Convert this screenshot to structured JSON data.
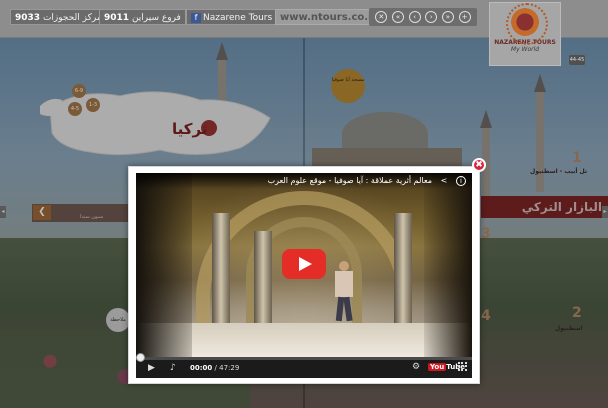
{
  "topbar": {
    "center_pill": "9033",
    "center_pill_text": "مركز الحجوزات",
    "branches_pill": "9011",
    "branches_text": "فروع سيراين",
    "facebook_label": "Nazarene Tours",
    "url": "www.ntours.co.il",
    "nav_icons": [
      "close-icon",
      "first-icon",
      "prev-icon",
      "next-icon",
      "last-icon",
      "zoom-icon"
    ]
  },
  "logo": {
    "name": "NAZARENE TOURS",
    "tagline": "My World"
  },
  "page_number": "44-45",
  "magazine": {
    "country": "تركيا",
    "callout": "مسجد أيا صوفيا",
    "section_title": "البازار التركي",
    "num1": "1",
    "title1": "تل أبيب - اسطنبول",
    "num2": "2",
    "title2": "اسطنبول",
    "num3": "3",
    "num4": "4",
    "note_label": "ملاحظة",
    "tool_label": "سنون سندا",
    "map_badges": [
      "4-5",
      "6-9",
      "1-3"
    ]
  },
  "video": {
    "title": "معالم أثرية عملاقة : آيا صوفيا - موقع علوم العرب",
    "current_time": "00:00",
    "separator": " / ",
    "duration": "47:29",
    "progress": 0,
    "youtube_label": "You",
    "youtube_tube": "Tube"
  },
  "colors": {
    "close_red": "#d7263d",
    "play_red": "#e52d27",
    "brand_dark_red": "#7c2424"
  }
}
